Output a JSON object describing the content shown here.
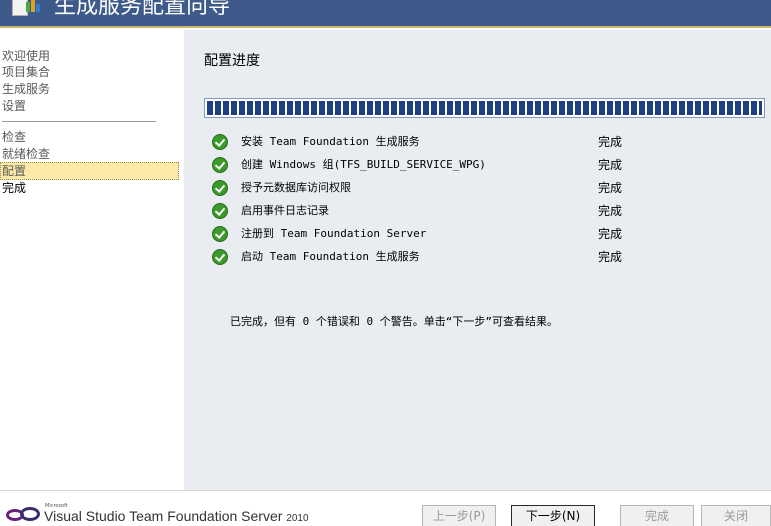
{
  "window": {
    "title": "生成服务配置向导"
  },
  "sidebar": {
    "items": [
      {
        "label": "欢迎使用"
      },
      {
        "label": "项目集合"
      },
      {
        "label": "生成服务"
      },
      {
        "label": "设置"
      },
      {
        "label": "检查"
      },
      {
        "label": "就绪检查"
      },
      {
        "label": "配置"
      },
      {
        "label": "完成"
      }
    ],
    "active": "配置"
  },
  "main": {
    "title": "配置进度",
    "progress_percent": 100,
    "tasks": [
      {
        "label": "安装 Team Foundation 生成服务",
        "status": "完成",
        "icon": "success-check-icon"
      },
      {
        "label": "创建 Windows 组(TFS_BUILD_SERVICE_WPG)",
        "status": "完成",
        "icon": "success-check-icon"
      },
      {
        "label": "授予元数据库访问权限",
        "status": "完成",
        "icon": "success-check-icon"
      },
      {
        "label": "启用事件日志记录",
        "status": "完成",
        "icon": "success-check-icon"
      },
      {
        "label": "注册到 Team Foundation Server",
        "status": "完成",
        "icon": "success-check-icon"
      },
      {
        "label": "启动 Team Foundation 生成服务",
        "status": "完成",
        "icon": "success-check-icon"
      }
    ],
    "summary": "已完成，但有 0 个错误和 0 个警告。单击“下一步”可查看结果。"
  },
  "footer": {
    "logo_microsoft": "Microsoft",
    "logo_product": "Visual Studio Team Foundation Server",
    "logo_year": "2010",
    "buttons": {
      "previous": "上一步(P)",
      "next": "下一步(N)",
      "finish": "完成",
      "close": "关闭"
    }
  },
  "colors": {
    "titlebar": "#3d5a8a",
    "progress_fill": "#1f3f86",
    "success_green": "#3a9a2a",
    "active_nav": "#fce9a8"
  }
}
